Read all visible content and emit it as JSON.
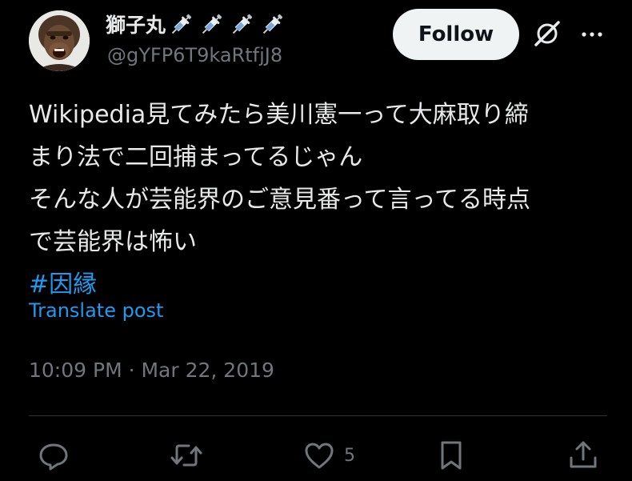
{
  "author": {
    "display_name": "獅子丸",
    "name_emojis": [
      "syringe-icon",
      "syringe-icon",
      "syringe-icon",
      "syringe-icon"
    ],
    "handle": "@gYFP6T9kaRtfjJ8"
  },
  "header": {
    "follow_label": "Follow"
  },
  "tweet": {
    "lines": [
      "Wikipedia見てみたら美川憲一って大麻取り締",
      "まり法で二回捕まってるじゃん",
      "そんな人が芸能界のご意見番って言ってる時点",
      "で芸能界は怖い"
    ],
    "hashtag": "#因縁",
    "translate_label": "Translate post",
    "timestamp": "10:09 PM · Mar 22, 2019"
  },
  "actions": {
    "reply_icon": "reply-icon",
    "retweet_icon": "retweet-icon",
    "like_icon": "heart-icon",
    "like_count": "5",
    "bookmark_icon": "bookmark-icon",
    "share_icon": "share-icon"
  },
  "colors": {
    "background": "#000000",
    "text": "#e7e9ea",
    "muted": "#71767b",
    "link": "#1d9bf0",
    "button_bg": "#eff3f4",
    "divider": "#2f3336"
  }
}
